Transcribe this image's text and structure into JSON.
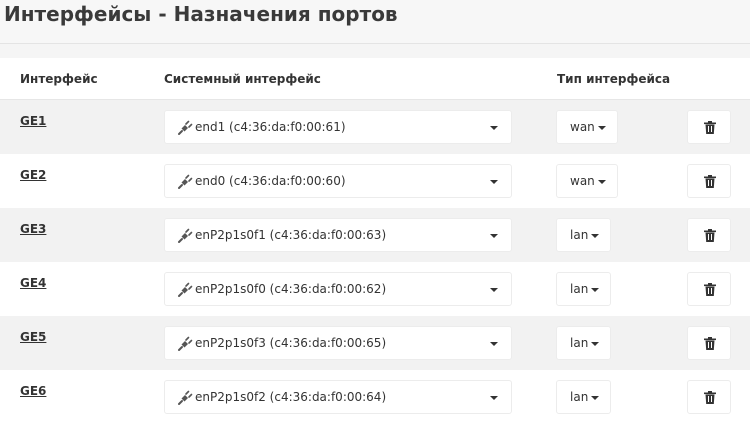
{
  "header": {
    "title": "Интерфейсы - Назначения портов"
  },
  "table": {
    "columns": {
      "interface": "Интерфейс",
      "system_interface": "Системный интерфейс",
      "interface_type": "Тип интерфейса"
    },
    "rows": [
      {
        "port": "GE1",
        "system": "end1 (c4:36:da:f0:00:61)",
        "type": "wan"
      },
      {
        "port": "GE2",
        "system": "end0 (c4:36:da:f0:00:60)",
        "type": "wan"
      },
      {
        "port": "GE3",
        "system": "enP2p1s0f1 (c4:36:da:f0:00:63)",
        "type": "lan"
      },
      {
        "port": "GE4",
        "system": "enP2p1s0f0 (c4:36:da:f0:00:62)",
        "type": "lan"
      },
      {
        "port": "GE5",
        "system": "enP2p1s0f3 (c4:36:da:f0:00:65)",
        "type": "lan"
      },
      {
        "port": "GE6",
        "system": "enP2p1s0f2 (c4:36:da:f0:00:64)",
        "type": "lan"
      }
    ]
  },
  "icons": {
    "system_interface": "plug-icon",
    "dropdown": "caret-down-icon",
    "delete": "trash-icon"
  }
}
